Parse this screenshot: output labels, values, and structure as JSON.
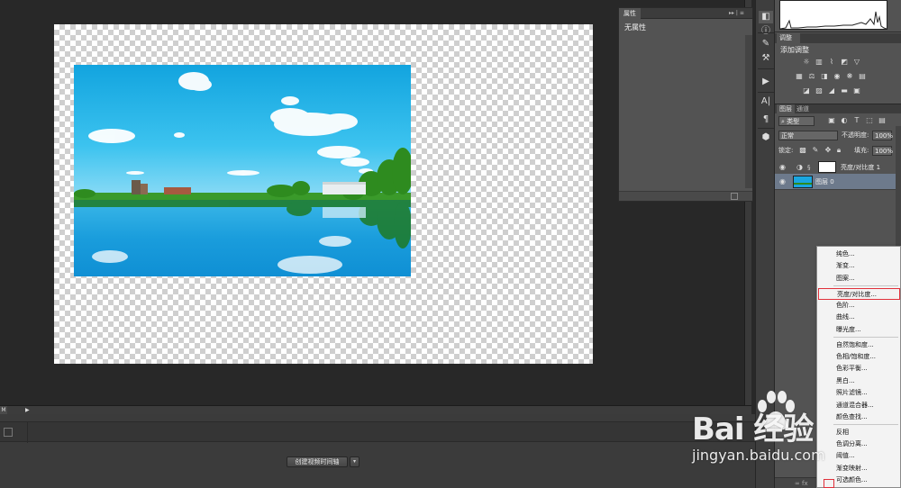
{
  "timeline": {
    "create_video_button": "创建视频时间轴",
    "dropdown_arrow": "▾",
    "play_glyph": "▶",
    "marker": "M"
  },
  "properties_panel": {
    "tab_label": "属性",
    "title": "无属性",
    "controls": "▸▸ | ≡"
  },
  "adjustments_panel": {
    "tab_label": "调整",
    "title": "添加调整"
  },
  "layers_panel": {
    "tab_layers": "图层",
    "tab_channels": "通道",
    "filter_kind": "类型",
    "blend_mode": "正常",
    "opacity_label": "不透明度:",
    "opacity_value": "100%",
    "lock_label": "锁定:",
    "fill_label": "填充:",
    "fill_value": "100%",
    "layers": [
      {
        "name": "亮度/对比度 1",
        "type": "adjustment"
      },
      {
        "name": "图层 0",
        "type": "pixel"
      }
    ],
    "footer": "∞  fx"
  },
  "adjustment_menu": {
    "items": [
      "纯色...",
      "渐变...",
      "图案...",
      "亮度/对比度...",
      "色阶...",
      "曲线...",
      "曝光度...",
      "自然饱和度...",
      "色相/饱和度...",
      "色彩平衡...",
      "黑白...",
      "照片滤镜...",
      "通道混合器...",
      "颜色查找...",
      "反相",
      "色调分离...",
      "阈值...",
      "渐变映射...",
      "可选颜色..."
    ],
    "highlighted_item": "亮度/对比度..."
  },
  "watermark": {
    "logo_text": "Bai  经验",
    "url": "jingyan.baidu.com"
  },
  "colors": {
    "app_bg": "#282828",
    "panel_bg": "#535353",
    "menu_bg": "#f3f3f3",
    "highlight_border": "#e0303a",
    "sky_top": "#1aa6e0"
  },
  "icons": [
    "histogram-icon",
    "adjust-icon",
    "eye-icon",
    "lock-icon",
    "brush-icon",
    "move-icon",
    "mask-icon",
    "text-icon",
    "3d-icon"
  ]
}
